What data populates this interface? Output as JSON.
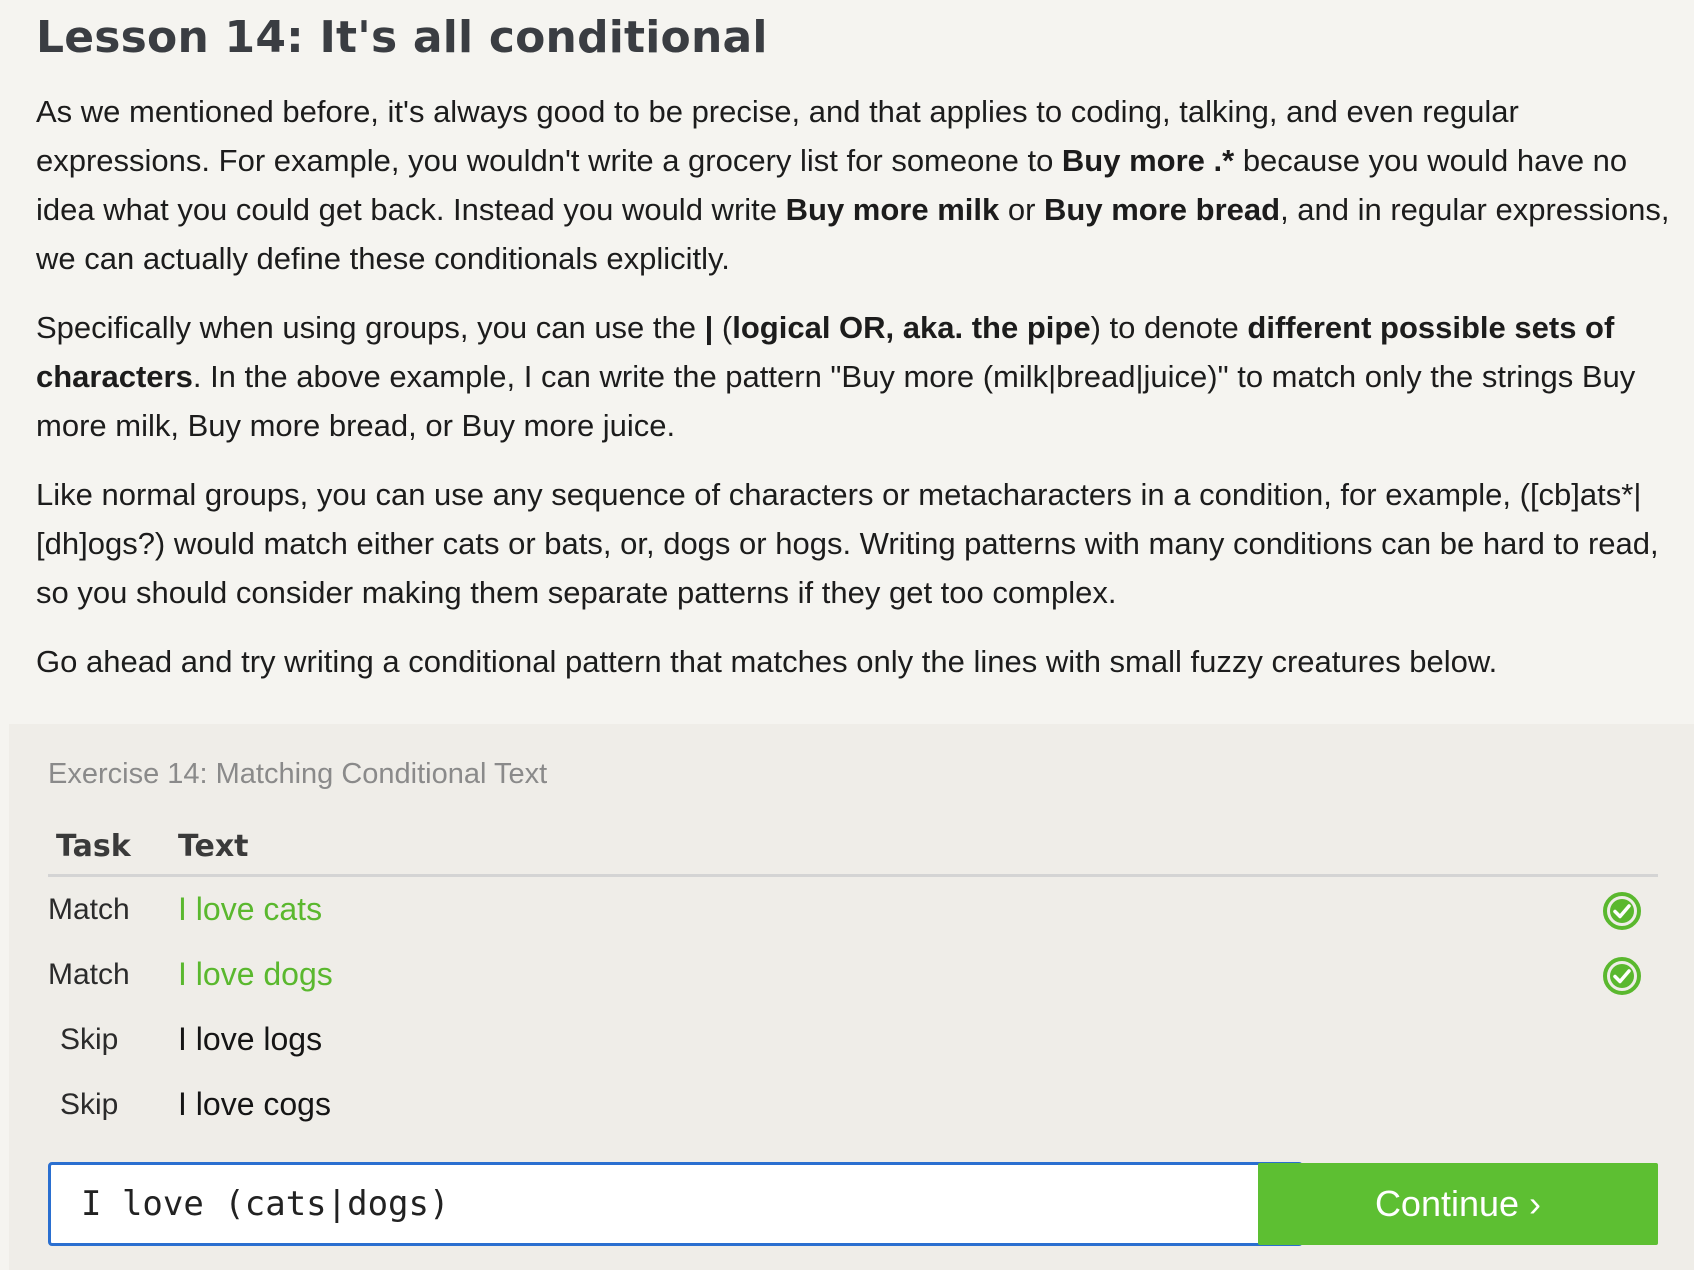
{
  "lesson": {
    "title": "Lesson 14: It's all conditional",
    "p1": [
      {
        "t": "As we mentioned before, it's always good to be precise, and that applies to coding, talking, and even regular expressions. For example, you wouldn't write a grocery list for someone to "
      },
      {
        "t": "Buy more .*",
        "b": true
      },
      {
        "t": " because you would have no idea what you could get back. Instead you would write "
      },
      {
        "t": "Buy more milk",
        "b": true
      },
      {
        "t": " or "
      },
      {
        "t": "Buy more bread",
        "b": true
      },
      {
        "t": ", and in regular expressions, we can actually define these conditionals explicitly."
      }
    ],
    "p2": [
      {
        "t": "Specifically when using groups, you can use the "
      },
      {
        "t": "|",
        "b": true
      },
      {
        "t": " ("
      },
      {
        "t": "logical OR, aka. the pipe",
        "b": true
      },
      {
        "t": ") to denote "
      },
      {
        "t": "different possible sets of characters",
        "b": true
      },
      {
        "t": ". In the above example, I can write the pattern \"Buy more (milk|bread|juice)\" to match only the strings Buy more milk, Buy more bread, or Buy more juice."
      }
    ],
    "p3": [
      {
        "t": "Like normal groups, you can use any sequence of characters or metacharacters in a condition, for example, ([cb]ats*|[dh]ogs?) would match either cats or bats, or, dogs or hogs. Writing patterns with many conditions can be hard to read, so you should consider making them separate patterns if they get too complex."
      }
    ],
    "p4": [
      {
        "t": "Go ahead and try writing a conditional pattern that matches only the lines with small fuzzy creatures below."
      }
    ]
  },
  "exercise": {
    "title": "Exercise 14: Matching Conditional Text",
    "col_task": "Task",
    "col_text": "Text",
    "rows": [
      {
        "task": "Match",
        "text": "I love cats",
        "matched": true,
        "icon": "check-circle-icon"
      },
      {
        "task": "Match",
        "text": "I love dogs",
        "matched": true,
        "icon": "check-circle-icon"
      },
      {
        "task": "Skip",
        "text": "I love logs",
        "matched": false
      },
      {
        "task": "Skip",
        "text": "I love cogs",
        "matched": false
      }
    ],
    "input_value": "I love (cats|dogs)",
    "continue_label": "Continue ›",
    "colors": {
      "accent_green": "#5dbf32",
      "match_text": "#5ab82e",
      "input_border": "#2a6fd0"
    }
  }
}
